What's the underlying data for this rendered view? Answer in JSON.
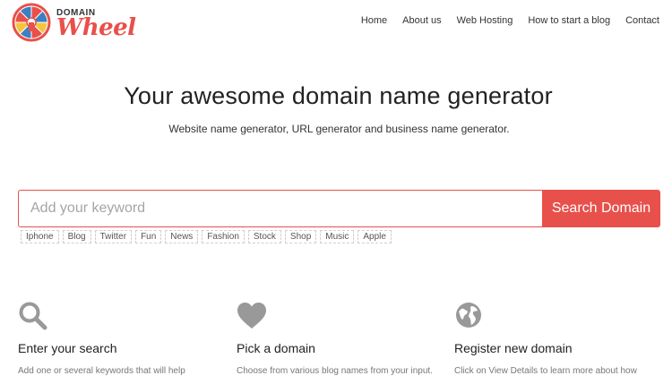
{
  "logo": {
    "top_word": "DOMAIN",
    "main_word": "Wheel",
    "icon": "wheel-logo-icon",
    "colors": {
      "red": "#e8504b",
      "blue": "#3b7fc4",
      "yellow": "#f5c542"
    }
  },
  "nav": {
    "items": [
      "Home",
      "About us",
      "Web Hosting",
      "How to start a blog",
      "Contact"
    ]
  },
  "hero": {
    "title": "Your awesome domain name generator",
    "subtitle": "Website name generator, URL generator and business name generator."
  },
  "search": {
    "placeholder": "Add your keyword",
    "button_label": "Search Domain",
    "accent": "#e8504b"
  },
  "tags": [
    "Iphone",
    "Blog",
    "Twitter",
    "Fun",
    "News",
    "Fashion",
    "Stock",
    "Shop",
    "Music",
    "Apple"
  ],
  "features": [
    {
      "icon": "search-icon",
      "title": "Enter your search",
      "text": "Add one or several keywords that will help"
    },
    {
      "icon": "heart-icon",
      "title": "Pick a domain",
      "text": "Choose from various blog names from your input."
    },
    {
      "icon": "globe-icon",
      "title": "Register new domain",
      "text": "Click on View Details to learn more about how"
    }
  ],
  "icon_color": "#999999"
}
